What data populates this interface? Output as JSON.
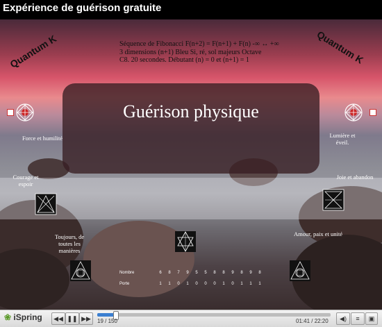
{
  "window": {
    "title": "Expérience de guérison gratuite"
  },
  "slide": {
    "quantum_left": "Quantum K",
    "quantum_right": "Quantum K",
    "fib_line1": "Séquence de Fibonacci F(n+2) = F(n+1) + F(n) -∞ ↔ +∞",
    "fib_line2": "3 dimensions (n+1) Bleu Si, ré, sol majeurs Octave",
    "fib_line3": "C8. 20 secondes. Débutant (n) = 0 et (n+1) = 1",
    "panel_title": "Guérison physique",
    "labels": {
      "force": "Force et humilité",
      "courage": "Courage et espoir",
      "toujours": "Toujours, de toutes les manières",
      "lumiere": "Lumière et éveil.",
      "joie": "Joie et abandon",
      "amour": "Amour, paix et unité"
    },
    "table": {
      "row1_label": "Nombre",
      "row1_values": [
        "6",
        "8",
        "7",
        "9",
        "5",
        "5",
        "8",
        "8",
        "9",
        "8",
        "9",
        "8"
      ],
      "row2_label": "Porte",
      "row2_values": [
        "1",
        "1",
        "0",
        "1",
        "0",
        "0",
        "0",
        "1",
        "0",
        "1",
        "1",
        "1"
      ]
    }
  },
  "player": {
    "logo": "iSpring",
    "slide_counter": "19 / 150",
    "time": "01:41 / 22:20",
    "progress_fraction": 0.076,
    "accent_color": "#3b7fd1"
  }
}
